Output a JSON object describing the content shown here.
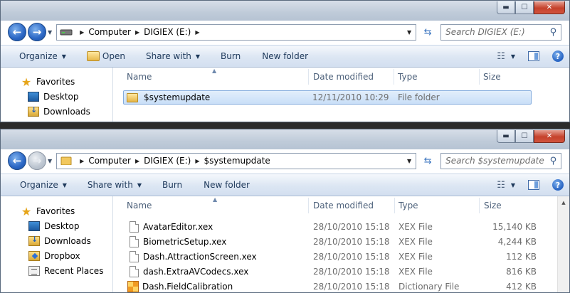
{
  "window1": {
    "window_controls": {
      "minimize": "▬",
      "maximize": "☐",
      "close": "✕"
    },
    "address": {
      "crumbs": [
        "Computer",
        "DIGIEX (E:)"
      ],
      "search_placeholder": "Search DIGIEX (E:)"
    },
    "toolbar": {
      "organize": "Organize",
      "open": "Open",
      "share_with": "Share with",
      "burn": "Burn",
      "new_folder": "New folder"
    },
    "nav": {
      "favorites": "Favorites",
      "desktop": "Desktop",
      "downloads": "Downloads"
    },
    "columns": {
      "name": "Name",
      "date_modified": "Date modified",
      "type": "Type",
      "size": "Size"
    },
    "files": [
      {
        "name": "$systemupdate",
        "date": "12/11/2010 10:29",
        "type": "File folder",
        "size": "",
        "icon": "folder-icon",
        "selected": true
      }
    ]
  },
  "window2": {
    "window_controls": {
      "minimize": "▬",
      "maximize": "☐",
      "close": "✕"
    },
    "address": {
      "crumbs": [
        "Computer",
        "DIGIEX (E:)",
        "$systemupdate"
      ],
      "search_placeholder": "Search $systemupdate"
    },
    "toolbar": {
      "organize": "Organize",
      "share_with": "Share with",
      "burn": "Burn",
      "new_folder": "New folder"
    },
    "nav": {
      "favorites": "Favorites",
      "desktop": "Desktop",
      "downloads": "Downloads",
      "dropbox": "Dropbox",
      "recent_places": "Recent Places"
    },
    "columns": {
      "name": "Name",
      "date_modified": "Date modified",
      "type": "Type",
      "size": "Size"
    },
    "files": [
      {
        "name": "AvatarEditor.xex",
        "date": "28/10/2010 15:18",
        "type": "XEX File",
        "size": "15,140 KB"
      },
      {
        "name": "BiometricSetup.xex",
        "date": "28/10/2010 15:18",
        "type": "XEX File",
        "size": "4,244 KB"
      },
      {
        "name": "Dash.AttractionScreen.xex",
        "date": "28/10/2010 15:18",
        "type": "XEX File",
        "size": "112 KB"
      },
      {
        "name": "dash.ExtraAVCodecs.xex",
        "date": "28/10/2010 15:18",
        "type": "XEX File",
        "size": "816 KB"
      },
      {
        "name": "Dash.FieldCalibration",
        "date": "28/10/2010 15:18",
        "type": "Dictionary File",
        "size": "412 KB"
      }
    ]
  },
  "colors": {
    "titlebar": "#bfcbd9",
    "toolbar": "#dce6f3",
    "selection": "#c9dff8",
    "toolbar_text": "#1e395b"
  }
}
